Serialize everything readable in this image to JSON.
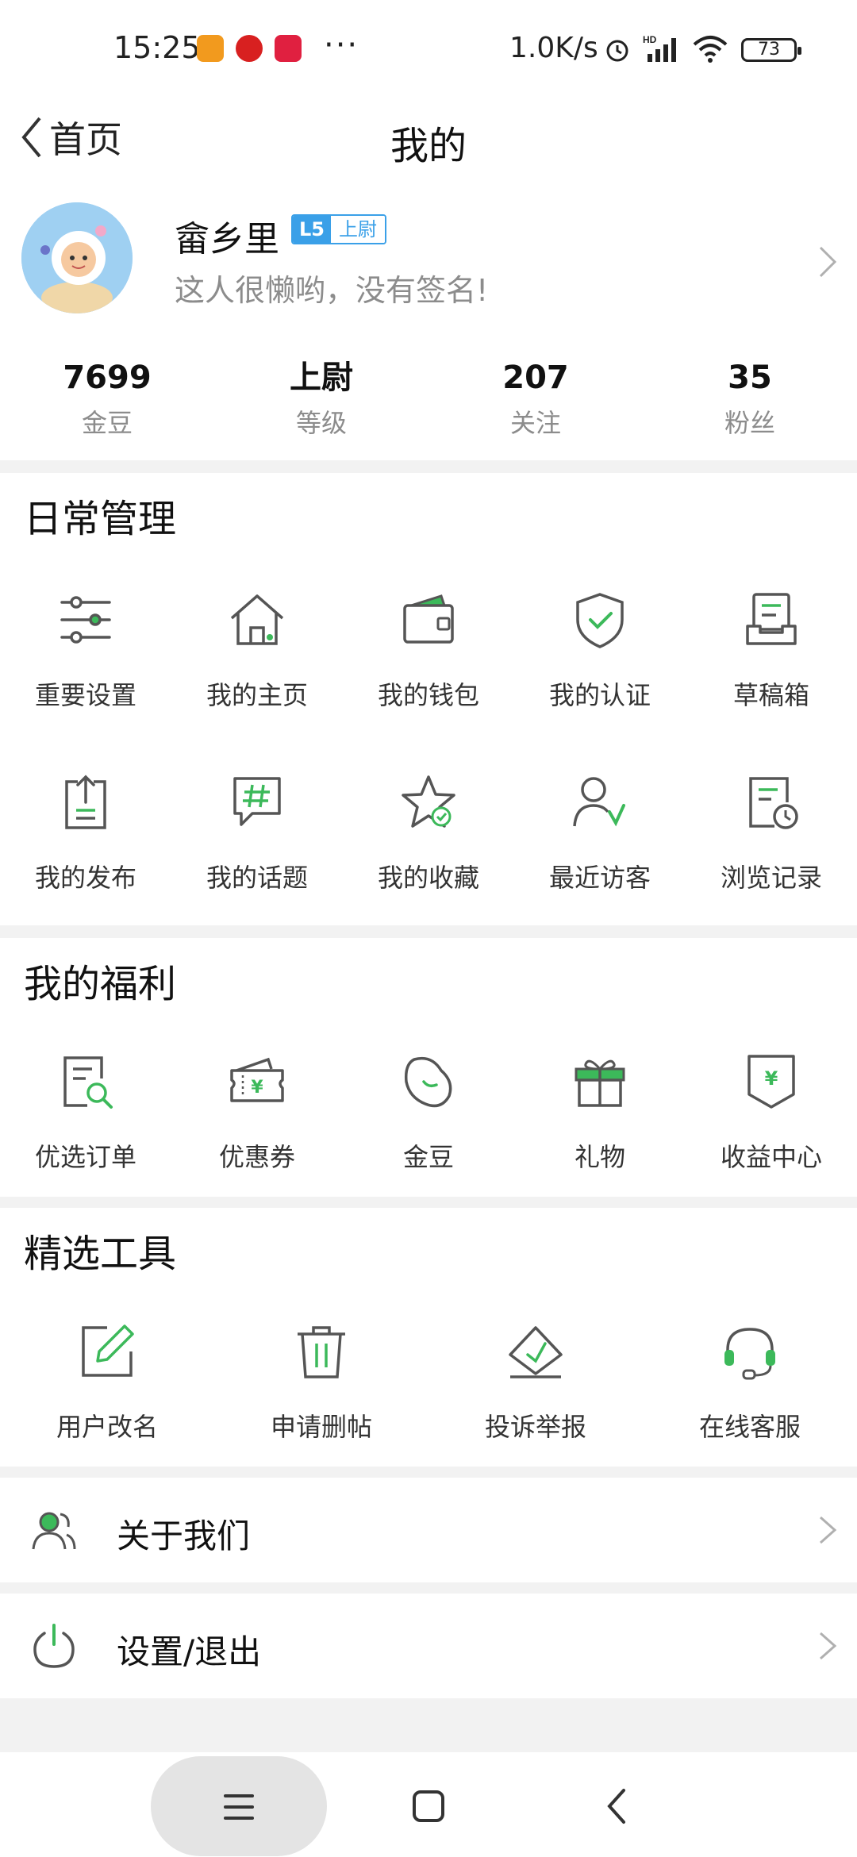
{
  "status_bar": {
    "time": "15:25",
    "net_speed": "1.0K/s",
    "battery": "73"
  },
  "nav": {
    "back_label": "首页",
    "title": "我的"
  },
  "profile": {
    "username": "畲乡里",
    "level_code": "L5",
    "level_name": "上尉",
    "signature": "这人很懒哟，没有签名!"
  },
  "stats": [
    {
      "value": "7699",
      "label": "金豆"
    },
    {
      "value": "上尉",
      "label": "等级"
    },
    {
      "value": "207",
      "label": "关注"
    },
    {
      "value": "35",
      "label": "粉丝"
    }
  ],
  "daily": {
    "title": "日常管理",
    "items": [
      {
        "label": "重要设置",
        "icon": "sliders-icon"
      },
      {
        "label": "我的主页",
        "icon": "home-icon"
      },
      {
        "label": "我的钱包",
        "icon": "wallet-icon"
      },
      {
        "label": "我的认证",
        "icon": "shield-check-icon"
      },
      {
        "label": "草稿箱",
        "icon": "draft-box-icon"
      },
      {
        "label": "我的发布",
        "icon": "upload-icon"
      },
      {
        "label": "我的话题",
        "icon": "hashtag-icon"
      },
      {
        "label": "我的收藏",
        "icon": "star-icon"
      },
      {
        "label": "最近访客",
        "icon": "visitor-icon"
      },
      {
        "label": "浏览记录",
        "icon": "history-icon"
      }
    ]
  },
  "welfare": {
    "title": "我的福利",
    "items": [
      {
        "label": "优选订单",
        "icon": "order-search-icon"
      },
      {
        "label": "优惠券",
        "icon": "coupon-icon"
      },
      {
        "label": "金豆",
        "icon": "bean-icon"
      },
      {
        "label": "礼物",
        "icon": "gift-icon"
      },
      {
        "label": "收益中心",
        "icon": "income-icon"
      }
    ]
  },
  "tools": {
    "title": "精选工具",
    "items": [
      {
        "label": "用户改名",
        "icon": "edit-icon"
      },
      {
        "label": "申请删帖",
        "icon": "trash-icon"
      },
      {
        "label": "投诉举报",
        "icon": "report-icon"
      },
      {
        "label": "在线客服",
        "icon": "headset-icon"
      }
    ]
  },
  "rows": [
    {
      "label": "关于我们",
      "icon": "users-icon"
    },
    {
      "label": "设置/退出",
      "icon": "power-icon"
    }
  ],
  "colors": {
    "accent": "#3cb95a",
    "badge_blue": "#3aa0e8",
    "icon_gray": "#555555"
  }
}
